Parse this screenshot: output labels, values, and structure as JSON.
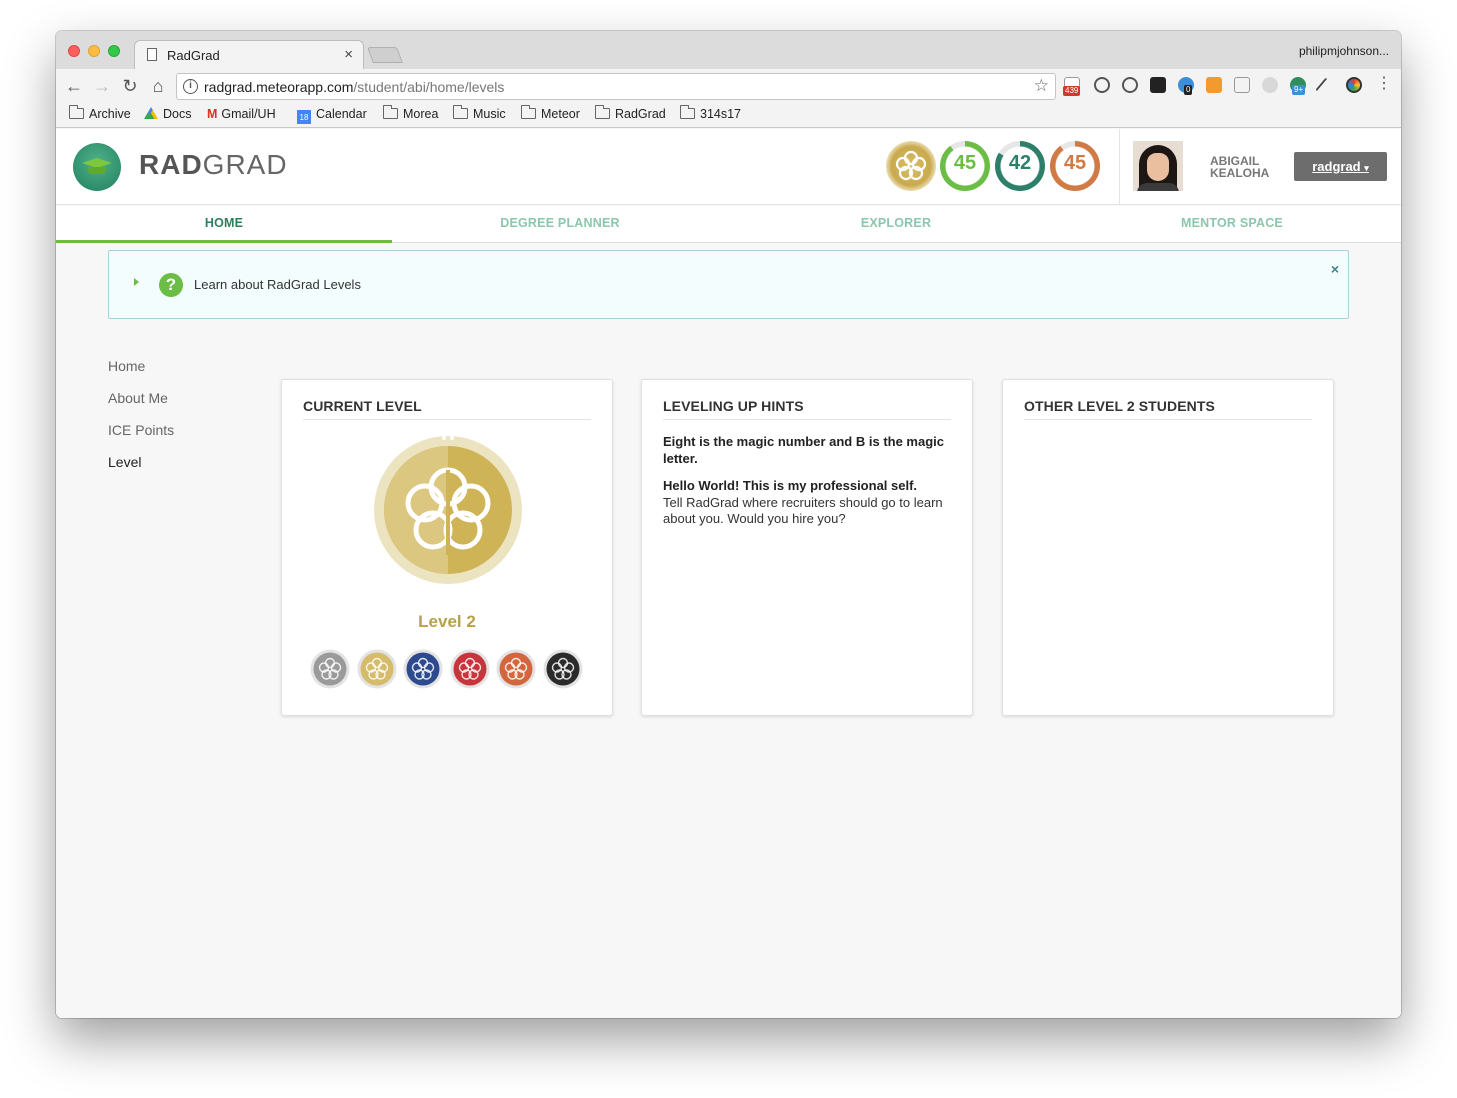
{
  "browser": {
    "tab_title": "RadGrad",
    "tab_close": "×",
    "profile": "philipmjohnson...",
    "url_host": "radgrad.meteorapp.com",
    "url_path": "/student/abi/home/levels",
    "ext_badges": [
      "439",
      "0",
      "9+"
    ]
  },
  "bookmarks": [
    {
      "label": "Archive",
      "icon": "folder-icon"
    },
    {
      "label": "Docs",
      "icon": "drive-icon"
    },
    {
      "label": "Gmail/UH",
      "icon": "gmail-icon"
    },
    {
      "label": "Calendar",
      "icon": "calendar-icon",
      "calendar_day": "18"
    },
    {
      "label": "Morea",
      "icon": "folder-icon"
    },
    {
      "label": "Music",
      "icon": "folder-icon"
    },
    {
      "label": "Meteor",
      "icon": "folder-icon"
    },
    {
      "label": "RadGrad",
      "icon": "folder-icon"
    },
    {
      "label": "314s17",
      "icon": "folder-icon"
    }
  ],
  "app": {
    "logo_bold": "RAD",
    "logo_rest": "GRAD",
    "scores": [
      {
        "value": "45",
        "color": "#6bbd45",
        "fill": 0.9
      },
      {
        "value": "42",
        "color": "#2d7f6a",
        "fill": 0.84
      },
      {
        "value": "45",
        "color": "#d07a46",
        "fill": 0.9
      }
    ],
    "user_first": "ABIGAIL",
    "user_last": "KEALOHA",
    "user_button": "radgrad",
    "menu": [
      "HOME",
      "DEGREE PLANNER",
      "EXPLORER",
      "MENTOR SPACE"
    ],
    "info_text": "Learn about RadGrad Levels",
    "info_close": "×",
    "sidenav": [
      "Home",
      "About Me",
      "ICE Points",
      "Level"
    ],
    "current_level": {
      "title": "CURRENT LEVEL",
      "label": "Level 2",
      "medal_colors": [
        "#9a9a9a",
        "#d4bc6a",
        "#2e4a8e",
        "#c8343b",
        "#d2673f",
        "#2b2b2b"
      ]
    },
    "hints": {
      "title": "LEVELING UP HINTS",
      "hint1": "Eight is the magic number and B is the magic letter.",
      "hint2_bold": "Hello World! This is my professional self.",
      "hint2_text": "Tell RadGrad where recruiters should go to learn about you. Would you hire you?"
    },
    "others": {
      "title": "OTHER LEVEL 2 STUDENTS"
    }
  }
}
